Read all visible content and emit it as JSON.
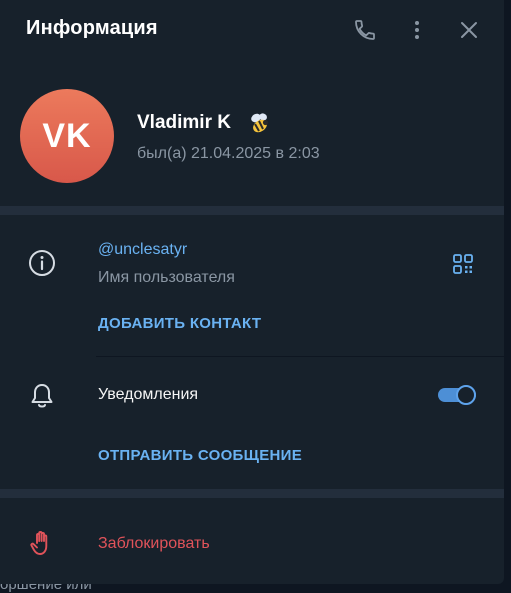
{
  "header": {
    "title": "Информация",
    "icons": [
      "phone-icon",
      "more-vertical-icon",
      "close-icon"
    ]
  },
  "profile": {
    "avatar_initials": "VK",
    "avatar_colors": [
      "#ec7a5c",
      "#d8584a"
    ],
    "name": "Vladimir K",
    "status_emoji": "bee-icon",
    "last_seen": "был(а) 21.04.2025 в 2:03"
  },
  "info": {
    "username": "@unclesatyr",
    "username_label": "Имя пользователя",
    "add_contact": "ДОБАВИТЬ КОНТАКТ"
  },
  "notifications": {
    "label": "Уведомления",
    "enabled": true,
    "send_message": "ОТПРАВИТЬ СООБЩЕНИЕ"
  },
  "block": {
    "label": "Заблокировать"
  },
  "backdrop": {
    "text": "оршение или"
  },
  "colors": {
    "panel": "#17212b",
    "accent": "#6ab2f2",
    "danger": "#e0535a",
    "muted": "#8a96a3"
  }
}
